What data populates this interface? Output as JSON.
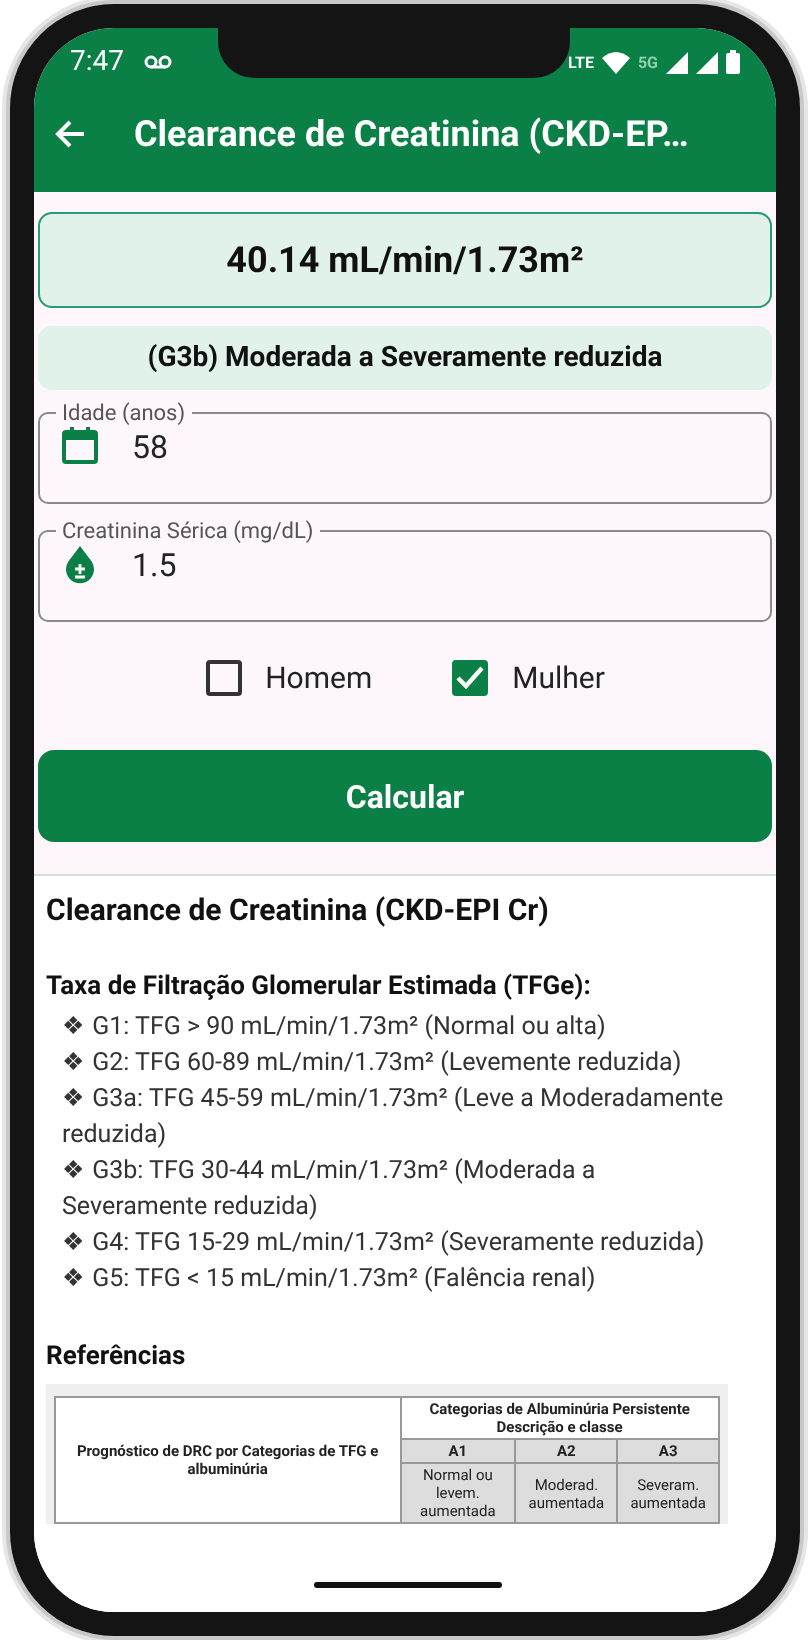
{
  "status_bar": {
    "time": "7:47",
    "network_labels": [
      "LTE",
      "5G"
    ]
  },
  "app_bar": {
    "title": "Clearance de Creatinina (CKD-EP…"
  },
  "result": {
    "value": "40.14 mL/min/1.73m²",
    "classification": "(G3b) Moderada a Severamente reduzida"
  },
  "fields": [
    {
      "label": "Idade (anos)",
      "value": "58",
      "kind": "calendar"
    },
    {
      "label": "Creatinina Sérica (mg/dL)",
      "value": "1.5",
      "kind": "drop"
    }
  ],
  "sex_options": [
    {
      "label": "Homem",
      "checked": false
    },
    {
      "label": "Mulher",
      "checked": true
    }
  ],
  "calculate_button": "Calcular",
  "info": {
    "title": "Clearance de Creatinina (CKD-EPI Cr)",
    "subtitle": "Taxa de Filtração Glomerular Estimada (TFGe):",
    "bullet": "❖",
    "items": [
      "G1: TFG > 90 mL/min/1.73m² (Normal ou alta)",
      "G2: TFG 60-89 mL/min/1.73m² (Levemente reduzida)",
      "G3a: TFG 45-59 mL/min/1.73m² (Leve a Moderadamente reduzida)",
      "G3b: TFG 30-44 mL/min/1.73m² (Moderada a Severamente reduzida)",
      "G4: TFG 15-29 mL/min/1.73m² (Severamente reduzida)",
      "G5: TFG < 15 mL/min/1.73m² (Falência renal)"
    ]
  },
  "references": {
    "title": "Referências",
    "table": {
      "row_heading": "Prognóstico de DRC por Categorias de TFG e albuminúria",
      "group_heading": "Categorias de Albuminúria Persistente Descrição e classe",
      "columns": [
        {
          "code": "A1",
          "description": "Normal ou levem. aumentada"
        },
        {
          "code": "A2",
          "description": "Moderad. aumentada"
        },
        {
          "code": "A3",
          "description": "Severam. aumentada"
        }
      ]
    }
  }
}
